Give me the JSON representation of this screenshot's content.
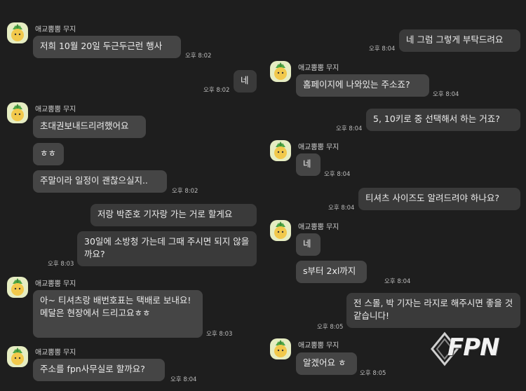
{
  "contact_name": "애교뿜뿜 무지",
  "left": {
    "messages": [
      {
        "text": "저희 10월 20일 두근두근런 행사",
        "time": "오후 8:02"
      },
      {
        "text": "네",
        "time": "오후 8:02"
      },
      {
        "text": "초대권보내드리려했어요"
      },
      {
        "text": "ㅎㅎ"
      },
      {
        "text": "주말이라 일정이 괜찮으실지..",
        "time": "오후 8:02"
      },
      {
        "text": "저랑 박준호 기자랑 가는 거로 할게요"
      },
      {
        "text": "30일에 소방청 가는데 그때 주시면 되지 않을까요?",
        "time": "오후 8:03"
      },
      {
        "text": "아~ 티셔츠랑 배번호표는 택배로 보내요!",
        "text2": "메달은 현장에서 드리고요ㅎㅎ",
        "time": "오후 8:03"
      },
      {
        "text": "주소를 fpn사무실로 할까요?",
        "time": "오후 8:04"
      }
    ]
  },
  "right": {
    "messages": [
      {
        "text": "네 그럼 그렇게 부탁드려요",
        "time": "오후 8:04"
      },
      {
        "text": "홈페이지에 나와있는 주소죠?",
        "time": "오후 8:04"
      },
      {
        "text": "5, 10키로 중 선택해서 하는 거죠?",
        "time": "오후 8:04"
      },
      {
        "text": "네",
        "time": "오후 8:04"
      },
      {
        "text": "티셔츠 사이즈도 알려드려야 하나요?",
        "time": "오후 8:04"
      },
      {
        "text": "네"
      },
      {
        "text": "s부터 2xl까지",
        "time": "오후 8:04"
      },
      {
        "text": "전 스몰, 박 기자는 라지로 해주시면 좋을 것 같습니다!",
        "time": "오후 8:05"
      },
      {
        "text": "알겠어요 ㅎ",
        "time": "오후 8:05"
      }
    ]
  },
  "watermark": "FPN",
  "colors": {
    "background": "#1e1e1e",
    "bubble": "#454545",
    "avatar_bg": "#e6edc2"
  }
}
